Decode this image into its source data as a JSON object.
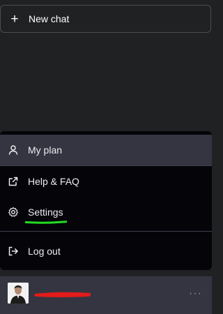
{
  "new_chat": {
    "label": "New chat",
    "icon": "plus-icon"
  },
  "menu": {
    "items": [
      {
        "label": "My plan",
        "icon": "user-icon"
      },
      {
        "label": "Help & FAQ",
        "icon": "external-link-icon"
      },
      {
        "label": "Settings",
        "icon": "gear-icon"
      },
      {
        "label": "Log out",
        "icon": "logout-icon"
      }
    ]
  },
  "footer": {
    "more_label": "···"
  },
  "colors": {
    "sidebar_bg": "#202123",
    "menu_bg": "#050509",
    "active_bg": "#343541",
    "highlight_underline": "#22dd22",
    "redaction": "#e31b1b"
  }
}
